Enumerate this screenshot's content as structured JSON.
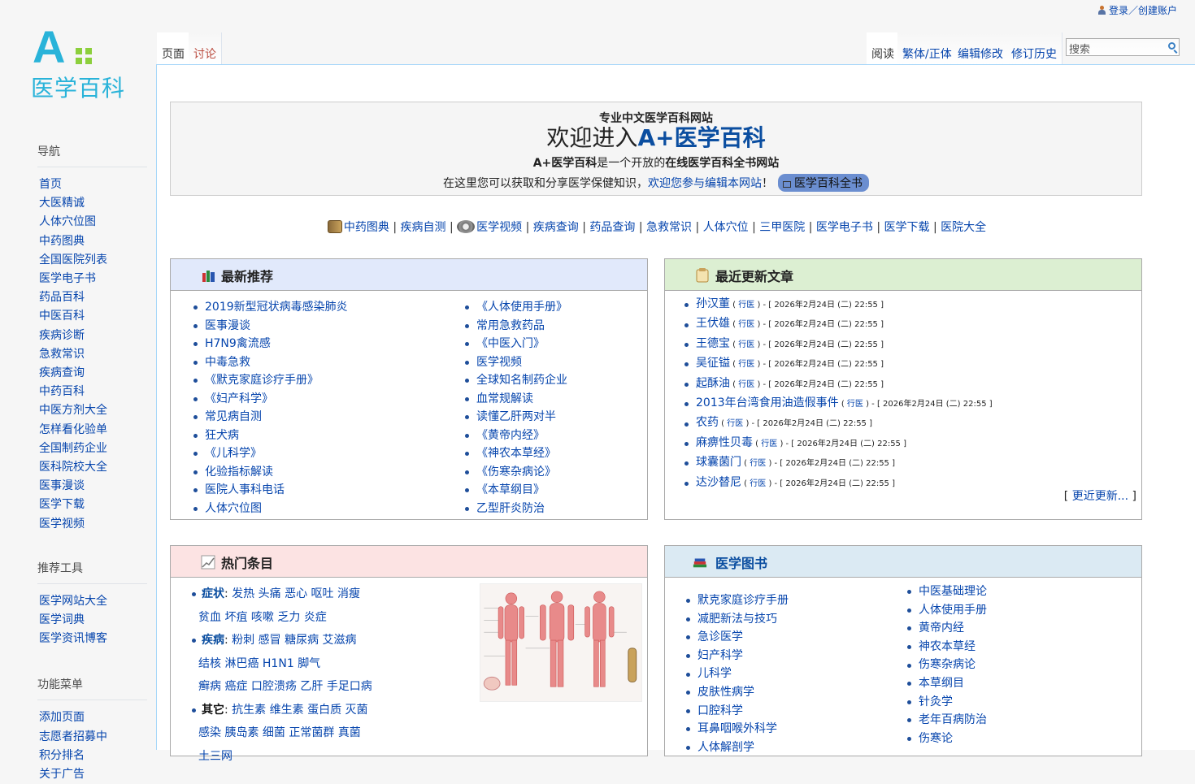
{
  "personal": {
    "login": "登录／创建账户"
  },
  "logo": {
    "mark": "A",
    "brand": "医学百科"
  },
  "sidebar": {
    "nav_title": "导航",
    "nav_items": [
      "首页",
      "大医精诚",
      "人体穴位图",
      "中药图典",
      "全国医院列表",
      "医学电子书",
      "药品百科",
      "中医百科",
      "疾病诊断",
      "急救常识",
      "疾病查询",
      "中药百科",
      "中医方剂大全",
      "怎样看化验单",
      "全国制药企业",
      "医科院校大全",
      "医事漫谈",
      "医学下载",
      "医学视频"
    ],
    "tools_title": "推荐工具",
    "tools_items": [
      "医学网站大全",
      "医学词典",
      "医学资讯博客"
    ],
    "func_title": "功能菜单",
    "func_items": [
      "添加页面",
      "志愿者招募中",
      "积分排名",
      "关于广告"
    ]
  },
  "tabs": {
    "page": "页面",
    "talk": "讨论",
    "read": "阅读",
    "variant": "繁体/正体",
    "edit": "编辑修改",
    "history": "修订历史"
  },
  "search": {
    "placeholder": "搜索"
  },
  "welcome": {
    "sub": "专业中文医学百科网站",
    "title_prefix": "欢迎进入",
    "title_brand": "A+医学百科",
    "line1_a": "A+医学百科",
    "line1_b": "是一个开放的",
    "line1_c": "在线医学百科全书网站",
    "line2_a": "在这里您可以获取和分享医学保健知识，",
    "line2_link": "欢迎您参与编辑本网站",
    "line2_b": "！",
    "pill": "医学百科全书"
  },
  "quicklinks": [
    "中药图典",
    "疾病自测",
    "医学视频",
    "疾病查询",
    "药品查询",
    "急救常识",
    "人体穴位",
    "三甲医院",
    "医学电子书",
    "医学下载",
    "医院大全"
  ],
  "latest": {
    "title": "最新推荐",
    "col1": [
      "2019新型冠状病毒感染肺炎",
      "医事漫谈",
      "H7N9禽流感",
      "中毒急救",
      "《默克家庭诊疗手册》",
      "《妇产科学》",
      "常见病自测",
      "狂犬病",
      "《儿科学》",
      "化验指标解读",
      "医院人事科电话",
      "人体穴位图"
    ],
    "col2": [
      "《人体使用手册》",
      "常用急救药品",
      "《中医入门》",
      "医学视频",
      "全球知名制药企业",
      "血常规解读",
      "读懂乙肝两对半",
      "《黄帝内经》",
      "《神农本草经》",
      "《伤寒杂病论》",
      "《本草纲目》",
      "乙型肝炎防治"
    ]
  },
  "recent": {
    "title": "最近更新文章",
    "tag": "行医",
    "items": [
      {
        "name": "孙汉董",
        "time": "2026年2月24日 (二) 22:55"
      },
      {
        "name": "王伏雄",
        "time": "2026年2月24日 (二) 22:55"
      },
      {
        "name": "王德宝",
        "time": "2026年2月24日 (二) 22:55"
      },
      {
        "name": "吴征镒",
        "time": "2026年2月24日 (二) 22:55"
      },
      {
        "name": "起酥油",
        "time": "2026年2月24日 (二) 22:55"
      },
      {
        "name": "2013年台湾食用油造假事件",
        "time": "2026年2月24日 (二) 22:55"
      },
      {
        "name": "农药",
        "time": "2026年2月24日 (二) 22:55"
      },
      {
        "name": "麻痹性贝毒",
        "time": "2026年2月24日 (二) 22:55"
      },
      {
        "name": "球囊菌门",
        "time": "2026年2月24日 (二) 22:55"
      },
      {
        "name": "达沙替尼",
        "time": "2026年2月24日 (二) 22:55"
      }
    ],
    "more": "更近更新..."
  },
  "hot": {
    "title": "热门条目",
    "symptom_label": "症状",
    "symptom_row1": [
      "发热",
      "头痛",
      "恶心",
      "呕吐",
      "消瘦"
    ],
    "symptom_row2": [
      "贫血",
      "坏疽",
      "咳嗽",
      "乏力",
      "炎症"
    ],
    "disease_label": "疾病",
    "disease_row1": [
      "粉刺",
      "感冒",
      "糖尿病",
      "艾滋病"
    ],
    "disease_row2": [
      "结核",
      "淋巴癌",
      "H1N1",
      "脚气"
    ],
    "disease_row3": [
      "癣病",
      "癌症",
      "口腔溃疡",
      "乙肝",
      "手足口病"
    ],
    "other_label": "其它",
    "other_row1": [
      "抗生素",
      "维生素",
      "蛋白质",
      "灭菌"
    ],
    "other_row2": [
      "感染",
      "胰岛素",
      "细菌",
      "正常菌群",
      "真菌"
    ],
    "other_row3": [
      "土三网"
    ]
  },
  "books": {
    "title": "医学图书",
    "col1": [
      "默克家庭诊疗手册",
      "减肥新法与技巧",
      "急诊医学",
      "妇产科学",
      "儿科学",
      "皮肤性病学",
      "口腔科学",
      "耳鼻咽喉外科学",
      "人体解剖学"
    ],
    "col2": [
      "中医基础理论",
      "人体使用手册",
      "黄帝内经",
      "神农本草经",
      "伤寒杂病论",
      "本草纲目",
      "针灸学",
      "老年百病防治",
      "伤寒论"
    ]
  },
  "colors": {
    "link": "#0645ad",
    "brand": "#29b3d9",
    "accent_green": "#8ccf3c",
    "latest_head": "#e1e9fb",
    "recent_head": "#dcefd2",
    "hot_head": "#fce3e3",
    "books_head": "#dbeaf3"
  }
}
